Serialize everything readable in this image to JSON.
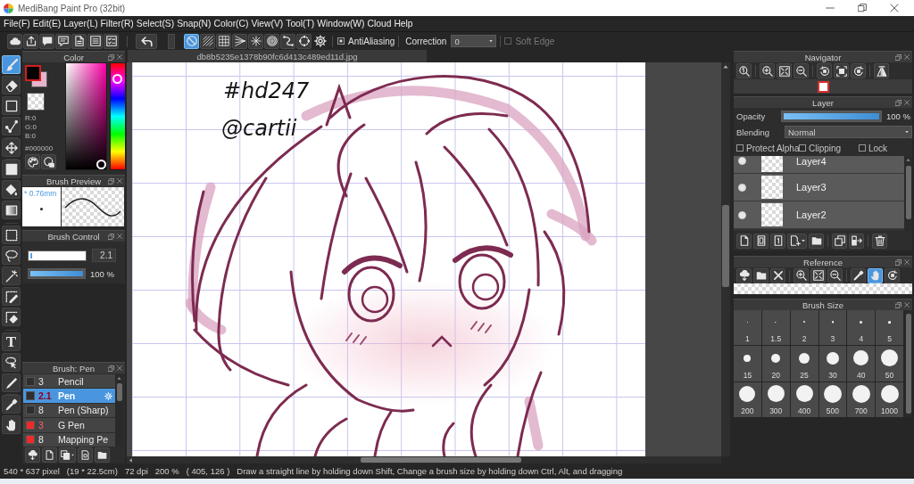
{
  "window": {
    "title": "MediBang Paint Pro (32bit)"
  },
  "menu": [
    "File(F)",
    "Edit(E)",
    "Layer(L)",
    "Filter(R)",
    "Select(S)",
    "Snap(N)",
    "Color(C)",
    "View(V)",
    "Tool(T)",
    "Window(W)",
    "Cloud",
    "Help"
  ],
  "toolbar": {
    "snap_tools": [
      {
        "selected": true
      },
      {
        "selected": false
      },
      {
        "selected": false
      },
      {
        "selected": false
      },
      {
        "selected": false
      },
      {
        "selected": false
      },
      {
        "selected": false
      },
      {
        "selected": false
      }
    ],
    "antialiasing": {
      "label": "AntiAliasing",
      "checked": true
    },
    "correction": {
      "label": "Correction",
      "value": "0"
    },
    "soft_edge": {
      "label": "Soft Edge",
      "checked": false,
      "disabled": true
    }
  },
  "tools": [
    {
      "selected": true
    },
    {
      "selected": false
    },
    {
      "selected": false
    },
    {
      "selected": false
    },
    {
      "selected": false
    },
    {
      "selected": false
    },
    {
      "selected": false
    },
    {
      "selected": false
    },
    {
      "selected": false
    },
    {
      "selected": false
    },
    {
      "selected": false
    },
    {
      "selected": false
    },
    {
      "selected": false
    },
    {
      "selected": false,
      "glyph": "T"
    },
    {
      "selected": false
    },
    {
      "selected": false
    },
    {
      "selected": false
    },
    {
      "selected": false
    }
  ],
  "color": {
    "title": "Color",
    "swatches": [
      {
        "color": "#000000",
        "selected": true
      },
      {
        "color": "#e8b4cc",
        "selected": false
      }
    ],
    "readouts": [
      "R:0",
      "G:0",
      "B:0"
    ],
    "hex": "#000000",
    "hue": {
      "level": 0.89
    }
  },
  "brush_preview": {
    "title": "Brush Preview",
    "size": "* 0.76mm"
  },
  "brush_control": {
    "title": "Brush Control",
    "size": {
      "level": 0.03,
      "value": "2.1"
    },
    "opacity": {
      "level": 1,
      "value": "100 %"
    }
  },
  "brush_list": {
    "title": "Brush: Pen",
    "items": [
      {
        "size": "3",
        "name": "Pencil",
        "color": "#2e2e2e",
        "size_marked": false,
        "selected": false
      },
      {
        "size": "2.1",
        "name": "Pen",
        "color": "#2e2e2e",
        "size_marked": true,
        "selected": true
      },
      {
        "size": "8",
        "name": "Pen (Sharp)",
        "color": "#2e2e2e",
        "size_marked": false,
        "selected": false
      },
      {
        "size": "3",
        "name": "G Pen",
        "color": "#f02a2a",
        "size_marked": true,
        "selected": false
      },
      {
        "size": "8",
        "name": "Mapping Pe",
        "color": "#f02a2a",
        "size_marked": false,
        "selected": false
      }
    ]
  },
  "canvas": {
    "tab": "db8b5235e1378b90fc6d413c489ed11d.jpg",
    "handwriting": [
      "#hd247",
      "@cartii"
    ]
  },
  "navigator": {
    "title": "Navigator"
  },
  "layer": {
    "title": "Layer",
    "opacity": {
      "label": "Opacity",
      "level": 1,
      "value": "100 %"
    },
    "blending": {
      "label": "Blending",
      "value": "Normal"
    },
    "options": [
      {
        "label": "Protect Alpha",
        "checked": false
      },
      {
        "label": "Clipping",
        "checked": false
      },
      {
        "label": "Lock",
        "checked": false
      }
    ],
    "layers": [
      {
        "name": "Layer4",
        "visible": true,
        "selected": false
      },
      {
        "name": "Layer3",
        "visible": true,
        "selected": false
      },
      {
        "name": "Layer2",
        "visible": true,
        "selected": false
      }
    ]
  },
  "reference": {
    "title": "Reference",
    "tools": [
      {
        "selected": false
      },
      {
        "selected": false
      },
      {
        "selected": false
      },
      {
        "selected": false
      },
      {
        "selected": false
      },
      {
        "selected": false
      },
      {
        "selected": false
      },
      {
        "selected": true
      },
      {
        "selected": false
      }
    ]
  },
  "brush_size": {
    "title": "Brush Size",
    "sizes": [
      "1",
      "1.5",
      "2",
      "3",
      "4",
      "5",
      "15",
      "20",
      "25",
      "30",
      "40",
      "50",
      "200",
      "300",
      "400",
      "500",
      "700",
      "1000"
    ]
  },
  "status_bar": {
    "items": [
      "540 * 637 pixel",
      "(19 * 22.5cm)",
      "72 dpi",
      "200 %",
      "( 405, 126 )"
    ],
    "hint": "Draw a straight line by holding down Shift, Change a brush size by holding down Ctrl, Alt, and dragging"
  }
}
